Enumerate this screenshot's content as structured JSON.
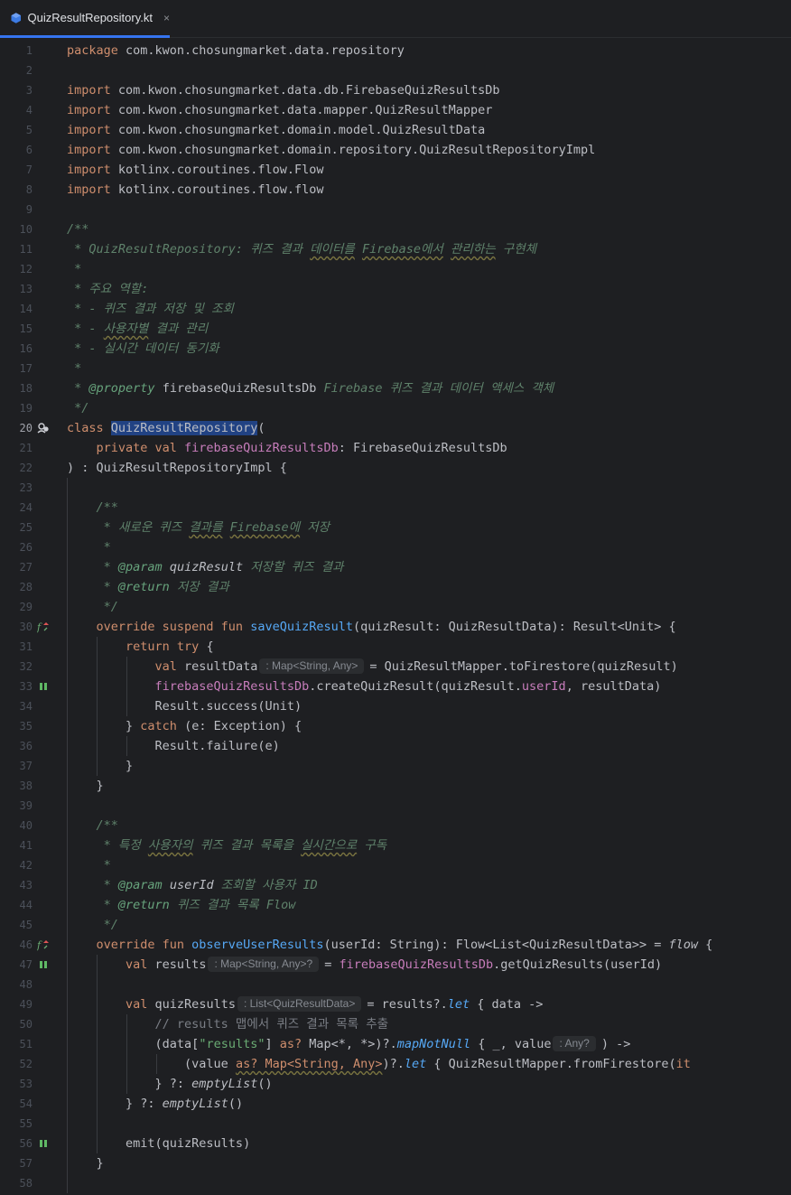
{
  "tab": {
    "filename": "QuizResultRepository.kt",
    "close_icon": "×"
  },
  "lines": [
    {
      "n": "1",
      "tokens": [
        [
          "kw",
          "package "
        ],
        [
          "",
          "com.kwon.chosungmarket.data.repository"
        ]
      ]
    },
    {
      "n": "2",
      "tokens": []
    },
    {
      "n": "3",
      "tokens": [
        [
          "kw",
          "import "
        ],
        [
          "",
          "com.kwon.chosungmarket.data.db.FirebaseQuizResultsDb"
        ]
      ]
    },
    {
      "n": "4",
      "tokens": [
        [
          "kw",
          "import "
        ],
        [
          "",
          "com.kwon.chosungmarket.data.mapper.QuizResultMapper"
        ]
      ]
    },
    {
      "n": "5",
      "tokens": [
        [
          "kw",
          "import "
        ],
        [
          "",
          "com.kwon.chosungmarket.domain.model.QuizResultData"
        ]
      ]
    },
    {
      "n": "6",
      "tokens": [
        [
          "kw",
          "import "
        ],
        [
          "",
          "com.kwon.chosungmarket.domain.repository.QuizResultRepositoryImpl"
        ]
      ]
    },
    {
      "n": "7",
      "tokens": [
        [
          "kw",
          "import "
        ],
        [
          "",
          "kotlinx.coroutines.flow.Flow"
        ]
      ]
    },
    {
      "n": "8",
      "tokens": [
        [
          "kw",
          "import "
        ],
        [
          "",
          "kotlinx.coroutines.flow.flow"
        ]
      ]
    },
    {
      "n": "9",
      "tokens": []
    },
    {
      "n": "10",
      "tokens": [
        [
          "doc",
          "/**"
        ]
      ]
    },
    {
      "n": "11",
      "tokens": [
        [
          "doc",
          " * QuizResultRepository: 퀴즈 결과 "
        ],
        [
          "doc typo",
          "데이터를"
        ],
        [
          "doc",
          " "
        ],
        [
          "doc typo",
          "Firebase에서"
        ],
        [
          "doc",
          " "
        ],
        [
          "doc typo",
          "관리하는"
        ],
        [
          "doc",
          " 구현체"
        ]
      ]
    },
    {
      "n": "12",
      "tokens": [
        [
          "doc",
          " *"
        ]
      ]
    },
    {
      "n": "13",
      "tokens": [
        [
          "doc",
          " * 주요 역할:"
        ]
      ]
    },
    {
      "n": "14",
      "tokens": [
        [
          "doc",
          " * - 퀴즈 결과 저장 및 조회"
        ]
      ]
    },
    {
      "n": "15",
      "tokens": [
        [
          "doc",
          " * - "
        ],
        [
          "doc typo",
          "사용자별"
        ],
        [
          "doc",
          " 결과 관리"
        ]
      ]
    },
    {
      "n": "16",
      "tokens": [
        [
          "doc",
          " * - 실시간 데이터 동기화"
        ]
      ]
    },
    {
      "n": "17",
      "tokens": [
        [
          "doc",
          " *"
        ]
      ]
    },
    {
      "n": "18",
      "tokens": [
        [
          "doc",
          " * "
        ],
        [
          "doctag",
          "@property"
        ],
        [
          "doc",
          " "
        ],
        [
          "",
          "firebaseQuizResultsDb"
        ],
        [
          "doc",
          " Firebase 퀴즈 결과 데이터 액세스 객체"
        ]
      ]
    },
    {
      "n": "19",
      "tokens": [
        [
          "doc",
          " */"
        ]
      ]
    },
    {
      "n": "20",
      "tokens": [
        [
          "kw",
          "class "
        ],
        [
          "sel",
          "QuizResultRepository"
        ],
        [
          "",
          "("
        ]
      ]
    },
    {
      "n": "21",
      "tokens": [
        [
          "kw",
          "    private val "
        ],
        [
          "prop",
          "firebaseQuizResultsDb"
        ],
        [
          "",
          ": FirebaseQuizResultsDb"
        ]
      ]
    },
    {
      "n": "22",
      "tokens": [
        [
          "",
          ") : QuizResultRepositoryImpl {"
        ]
      ]
    },
    {
      "n": "23",
      "tokens": []
    },
    {
      "n": "24",
      "tokens": [
        [
          "doc",
          "    /**"
        ]
      ]
    },
    {
      "n": "25",
      "tokens": [
        [
          "doc",
          "     * 새로운 퀴즈 "
        ],
        [
          "doc typo",
          "결과를"
        ],
        [
          "doc",
          " "
        ],
        [
          "doc typo",
          "Firebase에"
        ],
        [
          "doc",
          " 저장"
        ]
      ]
    },
    {
      "n": "26",
      "tokens": [
        [
          "doc",
          "     *"
        ]
      ]
    },
    {
      "n": "27",
      "tokens": [
        [
          "doc",
          "     * "
        ],
        [
          "doctag",
          "@param"
        ],
        [
          "doc",
          " "
        ],
        [
          "italic",
          "quizResult"
        ],
        [
          "doc",
          " 저장할 퀴즈 결과"
        ]
      ]
    },
    {
      "n": "28",
      "tokens": [
        [
          "doc",
          "     * "
        ],
        [
          "doctag",
          "@return"
        ],
        [
          "doc",
          " 저장 결과"
        ]
      ]
    },
    {
      "n": "29",
      "tokens": [
        [
          "doc",
          "     */"
        ]
      ]
    },
    {
      "n": "30",
      "tokens": [
        [
          "kw",
          "    override suspend fun "
        ],
        [
          "fn",
          "saveQuizResult"
        ],
        [
          "",
          "(quizResult: QuizResultData): Result<Unit> {"
        ]
      ]
    },
    {
      "n": "31",
      "tokens": [
        [
          "kw",
          "        return try "
        ],
        [
          "",
          "{"
        ]
      ]
    },
    {
      "n": "32",
      "tokens": [
        [
          "kw",
          "            val "
        ],
        [
          "",
          "resultData"
        ],
        [
          "hint",
          ": Map<String, Any>"
        ],
        [
          "",
          "= QuizResultMapper.toFirestore(quizResult)"
        ]
      ]
    },
    {
      "n": "33",
      "tokens": [
        [
          "prop",
          "            firebaseQuizResultsDb"
        ],
        [
          "",
          ".createQuizResult(quizResult."
        ],
        [
          "prop",
          "userId"
        ],
        [
          "",
          ", resultData)"
        ]
      ]
    },
    {
      "n": "34",
      "tokens": [
        [
          "",
          "            Result.success(Unit)"
        ]
      ]
    },
    {
      "n": "35",
      "tokens": [
        [
          "",
          "        } "
        ],
        [
          "kw",
          "catch "
        ],
        [
          "",
          "(e: Exception) {"
        ]
      ]
    },
    {
      "n": "36",
      "tokens": [
        [
          "",
          "            Result.failure(e)"
        ]
      ]
    },
    {
      "n": "37",
      "tokens": [
        [
          "",
          "        }"
        ]
      ]
    },
    {
      "n": "38",
      "tokens": [
        [
          "",
          "    }"
        ]
      ]
    },
    {
      "n": "39",
      "tokens": []
    },
    {
      "n": "40",
      "tokens": [
        [
          "doc",
          "    /**"
        ]
      ]
    },
    {
      "n": "41",
      "tokens": [
        [
          "doc",
          "     * 특정 "
        ],
        [
          "doc typo",
          "사용자의"
        ],
        [
          "doc",
          " 퀴즈 결과 목록을 "
        ],
        [
          "doc typo",
          "실시간으로"
        ],
        [
          "doc",
          " 구독"
        ]
      ]
    },
    {
      "n": "42",
      "tokens": [
        [
          "doc",
          "     *"
        ]
      ]
    },
    {
      "n": "43",
      "tokens": [
        [
          "doc",
          "     * "
        ],
        [
          "doctag",
          "@param"
        ],
        [
          "doc",
          " "
        ],
        [
          "italic",
          "userId"
        ],
        [
          "doc",
          " 조회할 사용자 ID"
        ]
      ]
    },
    {
      "n": "44",
      "tokens": [
        [
          "doc",
          "     * "
        ],
        [
          "doctag",
          "@return"
        ],
        [
          "doc",
          " 퀴즈 결과 목록 Flow"
        ]
      ]
    },
    {
      "n": "45",
      "tokens": [
        [
          "doc",
          "     */"
        ]
      ]
    },
    {
      "n": "46",
      "tokens": [
        [
          "kw",
          "    override fun "
        ],
        [
          "fn",
          "observeUserResults"
        ],
        [
          "",
          "(userId: String): Flow<List<QuizResultData>> = "
        ],
        [
          "italic",
          "flow"
        ],
        [
          "",
          " {"
        ]
      ]
    },
    {
      "n": "47",
      "tokens": [
        [
          "kw",
          "        val "
        ],
        [
          "",
          "results"
        ],
        [
          "hint",
          ": Map<String, Any>?"
        ],
        [
          "",
          "= "
        ],
        [
          "prop",
          "firebaseQuizResultsDb"
        ],
        [
          "",
          ".getQuizResults(userId)"
        ]
      ]
    },
    {
      "n": "48",
      "tokens": []
    },
    {
      "n": "49",
      "tokens": [
        [
          "kw",
          "        val "
        ],
        [
          "",
          "quizResults"
        ],
        [
          "hint",
          ": List<QuizResultData>"
        ],
        [
          "",
          "= results?."
        ],
        [
          "ext",
          "let"
        ],
        [
          "",
          " { data ->"
        ]
      ]
    },
    {
      "n": "50",
      "tokens": [
        [
          "cm",
          "            // results 맵에서 퀴즈 결과 목록 추출"
        ]
      ]
    },
    {
      "n": "51",
      "tokens": [
        [
          "",
          "            (data["
        ],
        [
          "str",
          "\"results\""
        ],
        [
          "",
          "] "
        ],
        [
          "kw",
          "as? "
        ],
        [
          "",
          "Map<*, *>)?."
        ],
        [
          "ext",
          "mapNotNull"
        ],
        [
          "",
          " { _, value"
        ],
        [
          "hint",
          ": Any?"
        ],
        [
          "",
          ") ->"
        ]
      ]
    },
    {
      "n": "52",
      "tokens": [
        [
          "",
          "                (value "
        ],
        [
          "kw typo",
          "as? Map<String, Any>"
        ],
        [
          "",
          ")?."
        ],
        [
          "ext",
          "let"
        ],
        [
          "",
          " { QuizResultMapper.fromFirestore("
        ],
        [
          "kw",
          "it"
        ],
        [
          ") }"
        ]
      ]
    },
    {
      "n": "53",
      "tokens": [
        [
          "",
          "            } ?: "
        ],
        [
          "italic",
          "emptyList"
        ],
        [
          "",
          "()"
        ]
      ]
    },
    {
      "n": "54",
      "tokens": [
        [
          "",
          "        } ?: "
        ],
        [
          "italic",
          "emptyList"
        ],
        [
          "",
          "()"
        ]
      ]
    },
    {
      "n": "55",
      "tokens": []
    },
    {
      "n": "56",
      "tokens": [
        [
          "",
          "        emit(quizResults)"
        ]
      ]
    },
    {
      "n": "57",
      "tokens": [
        [
          "",
          "    }"
        ]
      ]
    },
    {
      "n": "58",
      "tokens": []
    }
  ],
  "gutter_icons": {
    "20": "class-users-icon",
    "30": "override-suspend-icon",
    "33": "suspend-call-icon",
    "46": "override-suspend-icon",
    "47": "suspend-call-icon",
    "56": "suspend-call-icon"
  },
  "active_line": "20",
  "colors": {
    "background": "#1e1f22",
    "keyword": "#cf8e6d",
    "function": "#56a8f5",
    "property": "#c77dbb",
    "doc": "#5f826b",
    "string": "#6aab73",
    "selection": "#214283",
    "tab_underline": "#3574f0"
  }
}
